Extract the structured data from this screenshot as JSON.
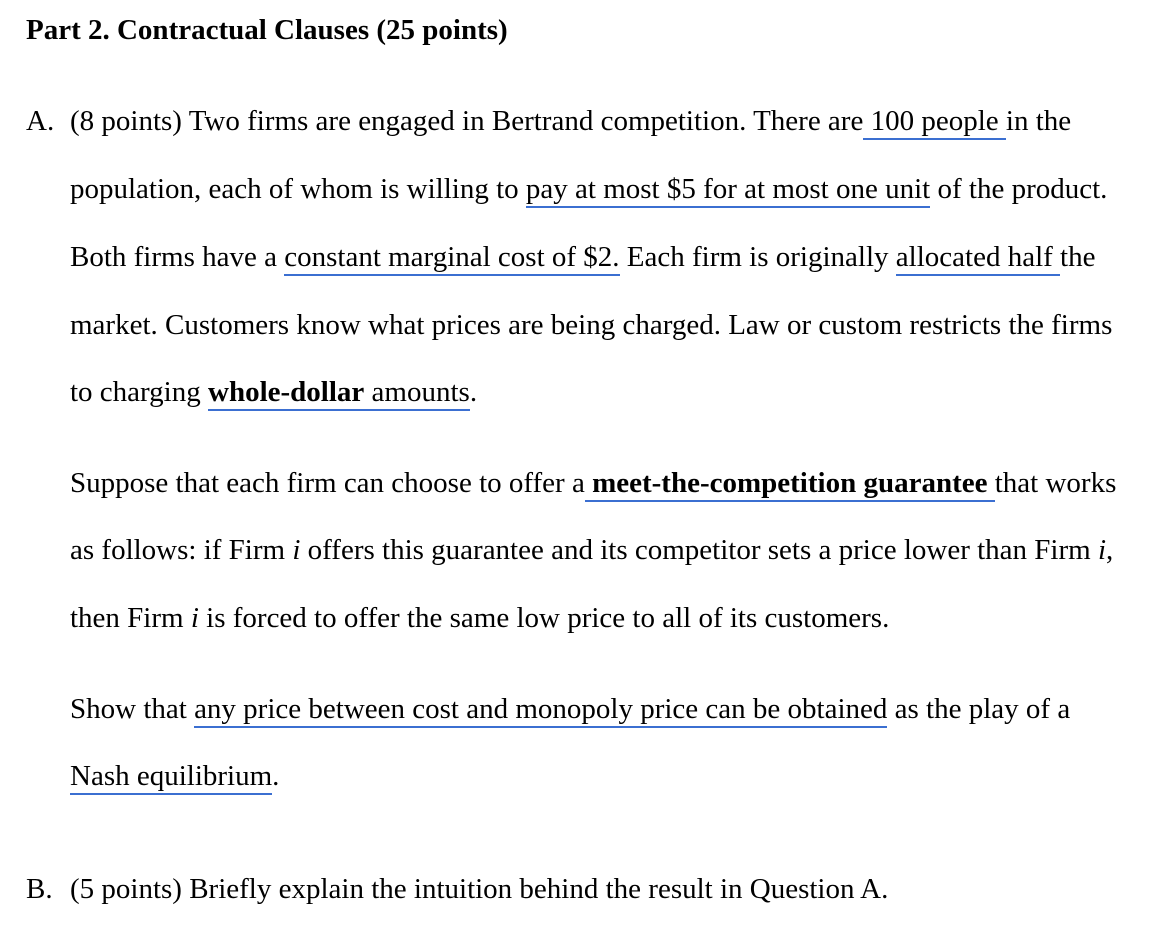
{
  "heading": "Part 2. Contractual Clauses (25 points)",
  "qa": {
    "marker": "A.",
    "l1": {
      "a": "(8 points) Two firms are engaged in Bertrand competition. There are",
      "u": " 100 people ",
      "b": "in the"
    },
    "l2": {
      "a": "population, each of whom is willing to ",
      "u": "pay at most $5 for at most one unit",
      "b": " of the product."
    },
    "l3": {
      "a": "Both firms have a ",
      "u1": "constant marginal cost of $2.",
      "b": " Each firm is originally ",
      "u2": "allocated half ",
      "c": "the"
    },
    "l4": "market. Customers know what prices are being charged. Law or custom restricts the firms",
    "l5": {
      "a": "to charging ",
      "ub": "whole-dollar",
      "u": " amounts",
      "b": "."
    },
    "p2l1": {
      "a": "Suppose that each firm can choose to offer a",
      "ub": " meet-the-competition guarantee ",
      "b": "that works"
    },
    "p2l2": {
      "a": "as follows: if Firm ",
      "i1": "i",
      "b": " offers this guarantee and its competitor sets a price lower than Firm ",
      "i2": "i",
      "c": ","
    },
    "p2l3": {
      "a": "then Firm ",
      "i1": "i",
      "b": " is forced to offer the same low price to all of its customers."
    },
    "p3l1": {
      "a": "Show that ",
      "u": "any price between cost and monopoly price can be obtained",
      "b": " as the play of a"
    },
    "p3l2": {
      "u": "Nash equilibrium",
      "b": "."
    }
  },
  "qb": {
    "marker": "B.",
    "text": "(5 points) Briefly explain the intuition behind the result in Question A."
  }
}
